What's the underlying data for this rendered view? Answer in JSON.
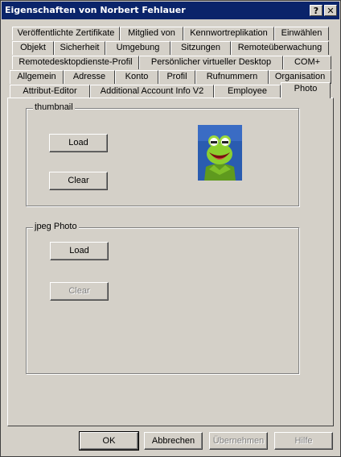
{
  "window": {
    "title": "Eigenschaften von Norbert Fehlauer",
    "help_glyph": "?",
    "close_glyph": "✕"
  },
  "tabs": {
    "row1": [
      "Veröffentlichte Zertifikate",
      "Mitglied von",
      "Kennwortreplikation",
      "Einwählen"
    ],
    "row2": [
      "Objekt",
      "Sicherheit",
      "Umgebung",
      "Sitzungen",
      "Remoteüberwachung"
    ],
    "row3": [
      "Remotedesktopdienste-Profil",
      "Persönlicher virtueller Desktop",
      "COM+"
    ],
    "row4": [
      "Allgemein",
      "Adresse",
      "Konto",
      "Profil",
      "Rufnummern",
      "Organisation"
    ],
    "row5": [
      "Attribut-Editor",
      "Additional Account Info V2",
      "Employee",
      "Photo"
    ]
  },
  "thumbnail": {
    "label": "thumbnail",
    "load": "Load",
    "clear": "Clear",
    "photo_icon": "kermit-photo"
  },
  "jpeg": {
    "label": "jpeg Photo",
    "load": "Load",
    "clear": "Clear"
  },
  "footer": {
    "ok": "OK",
    "cancel": "Abbrechen",
    "apply": "Übernehmen",
    "help": "Hilfe"
  }
}
